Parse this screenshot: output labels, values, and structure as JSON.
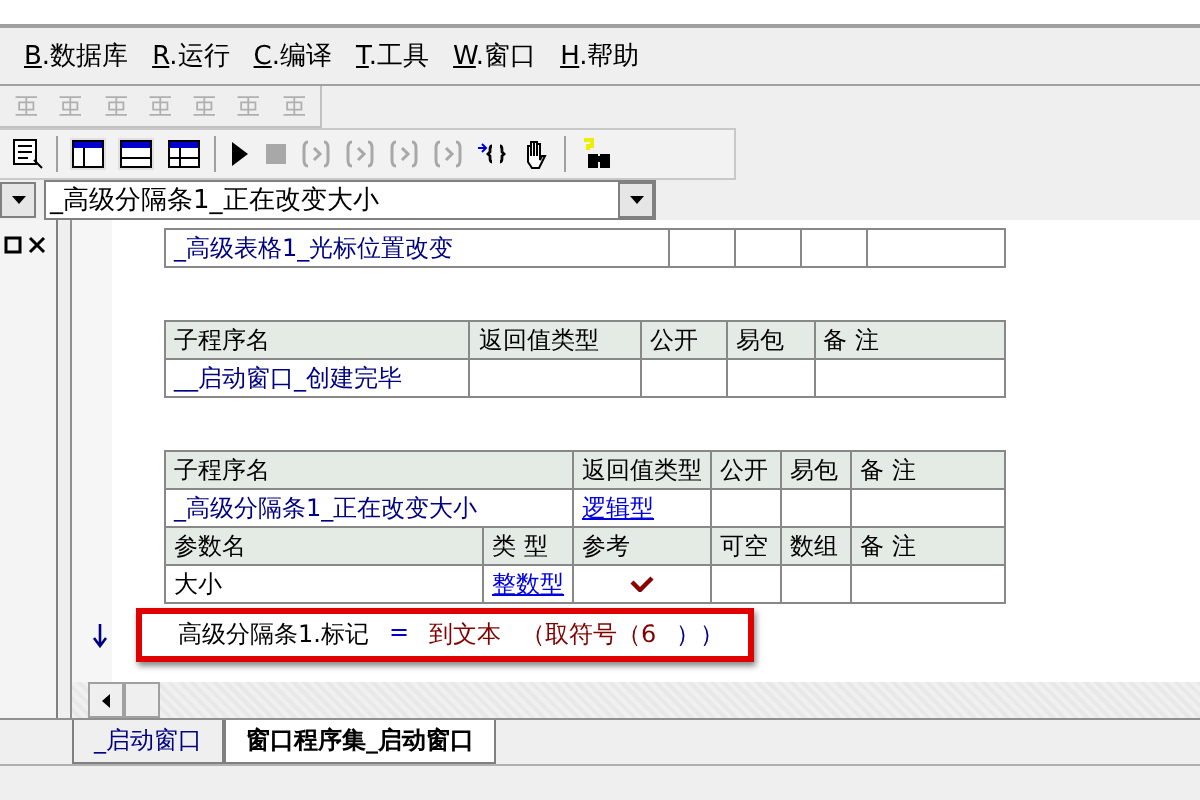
{
  "menu": [
    {
      "key": "B",
      "label": ".数据库"
    },
    {
      "key": "R",
      "label": ".运行"
    },
    {
      "key": "C",
      "label": ".编译"
    },
    {
      "key": "T",
      "label": ".工具"
    },
    {
      "key": "W",
      "label": ".窗口"
    },
    {
      "key": "H",
      "label": ".帮助"
    }
  ],
  "event_selector": {
    "value": "_高级分隔条1_正在改变大小"
  },
  "event_table": {
    "name": "_高级表格1_光标位置改变"
  },
  "subroutines": [
    {
      "columns": [
        "子程序名",
        "返回值类型",
        "公开",
        "易包",
        "备 注"
      ],
      "name": "__启动窗口_创建完毕"
    },
    {
      "columns": [
        "子程序名",
        "返回值类型",
        "公开",
        "易包",
        "备 注"
      ],
      "name": "_高级分隔条1_正在改变大小",
      "return_type": "逻辑型",
      "params": {
        "columns": [
          "参数名",
          "类 型",
          "参考",
          "可空",
          "数组",
          "备 注"
        ],
        "rows": [
          {
            "name": "大小",
            "type": "整数型",
            "reference": true
          }
        ]
      }
    }
  ],
  "code_line": {
    "highlighted": true,
    "tokens": [
      {
        "text": "高级分隔条1.标记",
        "kind": "variable"
      },
      {
        "text": "=",
        "kind": "operator"
      },
      {
        "text": "到文本",
        "kind": "command"
      },
      {
        "text": "（取符号（6",
        "kind": "command"
      },
      {
        "text": "））",
        "kind": "bracket"
      }
    ]
  },
  "editor_tabs": [
    {
      "label": "_启动窗口",
      "selected": false
    },
    {
      "label": "窗口程序集_启动窗口",
      "selected": true
    }
  ]
}
